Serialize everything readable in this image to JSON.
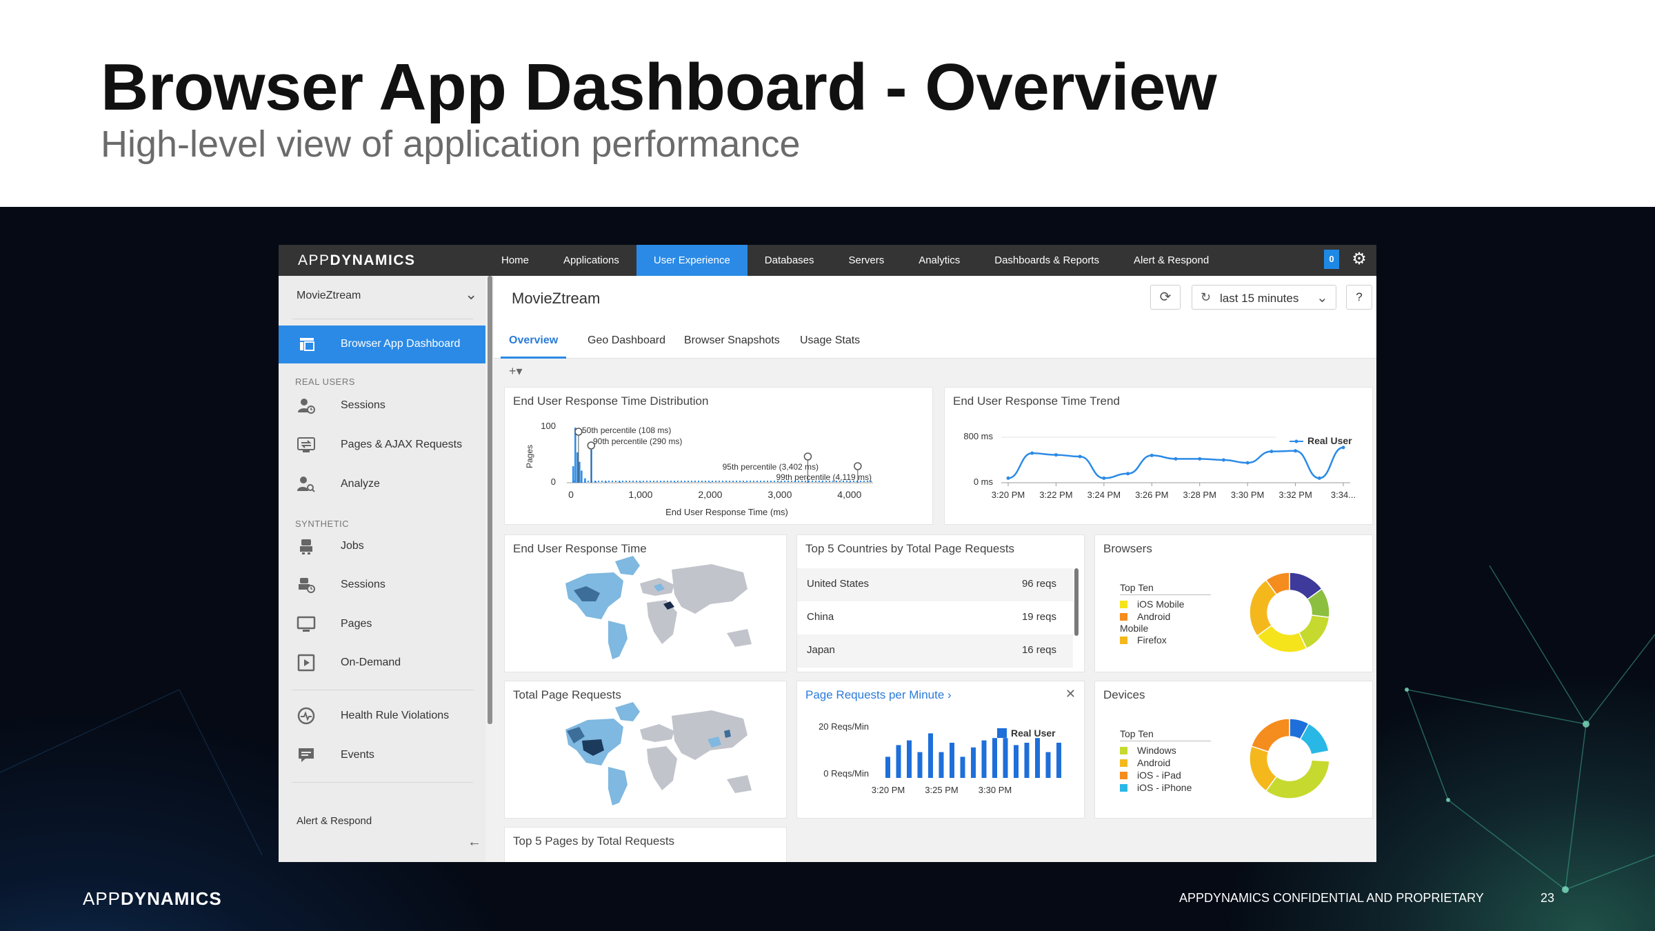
{
  "slide": {
    "title": "Browser App Dashboard - Overview",
    "subtitle": "High-level view of application performance",
    "footer_logo_light": "APP",
    "footer_logo_bold": "DYNAMICS",
    "confidential": "APPDYNAMICS CONFIDENTIAL AND PROPRIETARY",
    "page_number": "23"
  },
  "app": {
    "brand_light": "APP",
    "brand_bold": "DYNAMICS",
    "nav": [
      "Home",
      "Applications",
      "User Experience",
      "Databases",
      "Servers",
      "Analytics",
      "Dashboards & Reports",
      "Alert & Respond"
    ],
    "nav_active": "User Experience",
    "notification_count": "0",
    "accent_color": "#2b8ae6"
  },
  "sidebar": {
    "app_name": "MovieZtream",
    "active_item": "Browser App Dashboard",
    "real_users_label": "REAL USERS",
    "real_users": [
      "Sessions",
      "Pages & AJAX Requests",
      "Analyze"
    ],
    "synthetic_label": "SYNTHETIC",
    "synthetic": [
      "Jobs",
      "Sessions",
      "Pages",
      "On-Demand"
    ],
    "other": [
      "Health Rule Violations",
      "Events"
    ],
    "bottom": "Alert & Respond"
  },
  "content": {
    "title": "MovieZtream",
    "time_range": "last 15 minutes",
    "help": "?",
    "tabs": [
      "Overview",
      "Geo Dashboard",
      "Browser Snapshots",
      "Usage Stats"
    ],
    "add_widget": "+▾"
  },
  "widgets": {
    "dist": {
      "title": "End User Response Time Distribution",
      "ylabel": "Pages",
      "xlabel": "End User Response Time (ms)",
      "yticks": [
        "100",
        "0"
      ],
      "xticks": [
        "0",
        "1,000",
        "2,000",
        "3,000",
        "4,000"
      ],
      "annotations": [
        "50th percentile (108 ms)",
        "90th percentile (290 ms)",
        "95th percentile (3,402 ms)",
        "99th percentile (4,119 ms)"
      ]
    },
    "trend": {
      "title": "End User Response Time Trend",
      "yticks": [
        "800 ms",
        "0 ms"
      ],
      "xticks": [
        "3:20 PM",
        "3:22 PM",
        "3:24 PM",
        "3:26 PM",
        "3:28 PM",
        "3:30 PM",
        "3:32 PM",
        "3:34..."
      ],
      "legend": "Real User"
    },
    "eurt_map": {
      "title": "End User Response Time"
    },
    "countries": {
      "title": "Top 5 Countries by Total Page Requests",
      "rows": [
        {
          "name": "United States",
          "value": "96 reqs"
        },
        {
          "name": "China",
          "value": "19 reqs"
        },
        {
          "name": "Japan",
          "value": "16 reqs"
        }
      ]
    },
    "browsers": {
      "title": "Browsers",
      "legend_title": "Top Ten",
      "items": [
        "iOS Mobile",
        "Android",
        "Mobile",
        "Firefox"
      ],
      "colors": [
        "#f5e31c",
        "#f58c1e",
        "#ffffff",
        "#f5b81c"
      ]
    },
    "tpr_map": {
      "title": "Total Page Requests"
    },
    "ppm": {
      "title": "Page Requests per Minute",
      "yticks": [
        "20 Reqs/Min",
        "0 Reqs/Min"
      ],
      "xticks": [
        "3:20 PM",
        "3:25 PM",
        "3:30 PM"
      ],
      "legend": "Real User"
    },
    "devices": {
      "title": "Devices",
      "legend_title": "Top Ten",
      "items": [
        "Windows",
        "Android",
        "iOS - iPad",
        "iOS - iPhone"
      ],
      "colors": [
        "#c6d92e",
        "#f5b81c",
        "#f58c1e",
        "#29b8e6"
      ]
    },
    "top_pages": {
      "title": "Top 5 Pages by Total Requests"
    }
  },
  "chart_data": [
    {
      "type": "bar",
      "title": "End User Response Time Distribution",
      "xlabel": "End User Response Time (ms)",
      "ylabel": "Pages",
      "xlim": [
        0,
        4200
      ],
      "ylim": [
        0,
        100
      ],
      "x": [
        30,
        60,
        90,
        120,
        150,
        200,
        290,
        350,
        500,
        700,
        1000,
        1500,
        2000,
        2500,
        3000,
        3400,
        3600,
        4000,
        4119
      ],
      "values": [
        30,
        100,
        55,
        38,
        22,
        8,
        60,
        3,
        2,
        2,
        1,
        1,
        1,
        1,
        1,
        1,
        1,
        1,
        1
      ],
      "percentiles": [
        {
          "label": "50th percentile (108 ms)",
          "value": 108
        },
        {
          "label": "90th percentile (290 ms)",
          "value": 290
        },
        {
          "label": "95th percentile (3,402 ms)",
          "value": 3402
        },
        {
          "label": "99th percentile (4,119 ms)",
          "value": 4119
        }
      ]
    },
    {
      "type": "line",
      "title": "End User Response Time Trend",
      "categories": [
        "3:20 PM",
        "3:21 PM",
        "3:22 PM",
        "3:23 PM",
        "3:24 PM",
        "3:25 PM",
        "3:26 PM",
        "3:27 PM",
        "3:28 PM",
        "3:29 PM",
        "3:30 PM",
        "3:31 PM",
        "3:32 PM",
        "3:33 PM",
        "3:34 PM"
      ],
      "series": [
        {
          "name": "Real User",
          "values": [
            80,
            520,
            490,
            460,
            80,
            160,
            480,
            420,
            420,
            400,
            350,
            550,
            560,
            80,
            620
          ]
        }
      ],
      "ylim": [
        0,
        800
      ]
    },
    {
      "type": "bar",
      "title": "Page Requests per Minute",
      "categories": [
        "3:20",
        "3:21",
        "3:22",
        "3:23",
        "3:24",
        "3:25",
        "3:26",
        "3:27",
        "3:28",
        "3:29",
        "3:30",
        "3:31",
        "3:32",
        "3:33",
        "3:34",
        "3:35",
        "3:36"
      ],
      "series": [
        {
          "name": "Real User",
          "values": [
            9,
            14,
            16,
            11,
            19,
            11,
            15,
            9,
            13,
            16,
            17,
            17,
            14,
            15,
            17,
            11,
            15
          ]
        }
      ],
      "ylim": [
        0,
        20
      ]
    },
    {
      "type": "pie",
      "title": "Browsers",
      "labels": [
        "Indigo",
        "Green",
        "Lime",
        "Yellow",
        "Amber",
        "Orange"
      ],
      "values": [
        15,
        12,
        16,
        22,
        25,
        10
      ],
      "colors": [
        "#3d3a9b",
        "#8cbf3f",
        "#c6d92e",
        "#f5e31c",
        "#f5b81c",
        "#f58c1e"
      ]
    },
    {
      "type": "pie",
      "title": "Devices",
      "labels": [
        "Blue",
        "Cyan",
        "Gap",
        "Lime",
        "Amber",
        "Orange"
      ],
      "values": [
        8,
        14,
        4,
        34,
        20,
        20
      ],
      "colors": [
        "#1e6fd9",
        "#29b8e6",
        "#ffffff",
        "#c6d92e",
        "#f5b81c",
        "#f58c1e"
      ]
    }
  ]
}
